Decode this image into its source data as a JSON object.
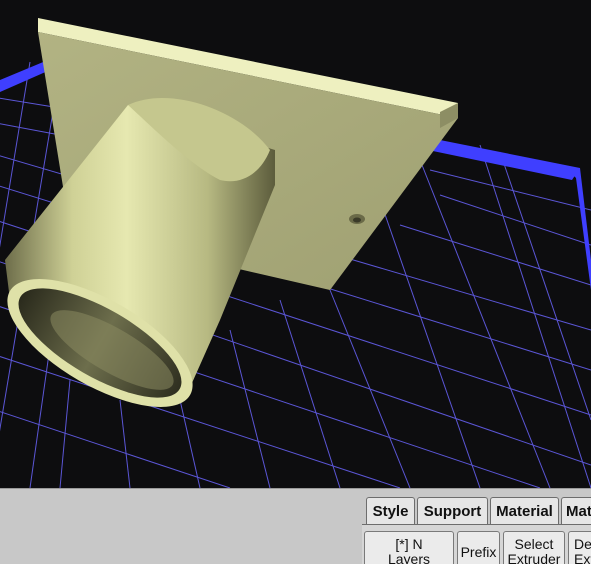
{
  "viewport": {
    "background_color": "#0d0d0f",
    "grid_color": "#5b56d6",
    "border_color": "#3f3fff",
    "model_color": "#e6e8b0",
    "model_parts": [
      "mounting-plate",
      "tube",
      "mounting-hole"
    ]
  },
  "panel": {
    "tabs": [
      {
        "label": "Style"
      },
      {
        "label": "Support"
      },
      {
        "label": "Material"
      },
      {
        "label": "Mat"
      }
    ],
    "buttons": [
      {
        "line1": "[*] N",
        "line2": "Layers"
      },
      {
        "line1": "Prefix",
        "line2": ""
      },
      {
        "line1": "Select",
        "line2": "Extruder"
      },
      {
        "line1": "De",
        "line2": "Ext"
      }
    ]
  }
}
